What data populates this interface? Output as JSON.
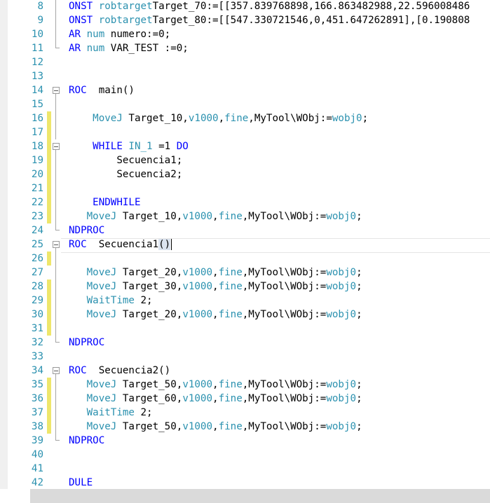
{
  "editor": {
    "lines": [
      {
        "n": "8",
        "m": "none",
        "f": "v",
        "s": [
          [
            "kw",
            "ONST "
          ],
          [
            "ty",
            "robtarget"
          ],
          [
            "",
            "Target_70:=[[357.839768898,166.863482988,22.596008486"
          ]
        ]
      },
      {
        "n": "9",
        "m": "none",
        "f": "v",
        "s": [
          [
            "kw",
            "ONST "
          ],
          [
            "ty",
            "robtarget"
          ],
          [
            "",
            "Target_80:=[[547.330721546,0,451.647262891],[0.190808"
          ]
        ]
      },
      {
        "n": "10",
        "m": "none",
        "f": "v",
        "s": [
          [
            "kw",
            "AR "
          ],
          [
            "ty",
            "num"
          ],
          [
            "",
            " numero:=0;"
          ]
        ]
      },
      {
        "n": "11",
        "m": "none",
        "f": "end",
        "s": [
          [
            "kw",
            "AR "
          ],
          [
            "ty",
            "num"
          ],
          [
            "",
            " VAR_TEST :=0;"
          ]
        ]
      },
      {
        "n": "12",
        "m": "none",
        "f": "",
        "s": []
      },
      {
        "n": "13",
        "m": "none",
        "f": "",
        "s": []
      },
      {
        "n": "14",
        "m": "none",
        "f": "box",
        "s": [
          [
            "kw",
            "ROC "
          ],
          [
            "",
            " main()"
          ]
        ]
      },
      {
        "n": "15",
        "m": "none",
        "f": "v",
        "s": []
      },
      {
        "n": "16",
        "m": "changed",
        "f": "v",
        "s": [
          [
            "",
            "    "
          ],
          [
            "ty",
            "MoveJ"
          ],
          [
            "",
            " Target_10,"
          ],
          [
            "ty",
            "v1000"
          ],
          [
            "",
            ","
          ],
          [
            "ty",
            "fine"
          ],
          [
            "",
            ",MyTool\\WObj:="
          ],
          [
            "ty",
            "wobj0"
          ],
          [
            "",
            ";"
          ]
        ]
      },
      {
        "n": "17",
        "m": "changed",
        "f": "v",
        "s": []
      },
      {
        "n": "18",
        "m": "changed",
        "f": "box",
        "s": [
          [
            "",
            "    "
          ],
          [
            "kw",
            "WHILE "
          ],
          [
            "ty",
            "IN_1"
          ],
          [
            "",
            " =1 "
          ],
          [
            "kw",
            "DO"
          ]
        ]
      },
      {
        "n": "19",
        "m": "changed",
        "f": "v",
        "s": [
          [
            "",
            "        Secuencia1;"
          ]
        ]
      },
      {
        "n": "20",
        "m": "changed",
        "f": "v",
        "s": [
          [
            "",
            "        Secuencia2;"
          ]
        ]
      },
      {
        "n": "21",
        "m": "changed",
        "f": "v",
        "s": []
      },
      {
        "n": "22",
        "m": "changed",
        "f": "v",
        "s": [
          [
            "",
            "    "
          ],
          [
            "kw",
            "ENDWHILE"
          ]
        ]
      },
      {
        "n": "23",
        "m": "changed",
        "f": "v",
        "s": [
          [
            "",
            "   "
          ],
          [
            "ty",
            "MoveJ"
          ],
          [
            "",
            " Target_10,"
          ],
          [
            "ty",
            "v1000"
          ],
          [
            "",
            ","
          ],
          [
            "ty",
            "fine"
          ],
          [
            "",
            ",MyTool\\WObj:="
          ],
          [
            "ty",
            "wobj0"
          ],
          [
            "",
            ";"
          ]
        ]
      },
      {
        "n": "24",
        "m": "none",
        "f": "end",
        "s": [
          [
            "kw",
            "NDPROC"
          ]
        ]
      },
      {
        "n": "25",
        "m": "none",
        "f": "box",
        "s": [
          [
            "kw",
            "ROC "
          ],
          [
            "",
            " Secuencia1"
          ],
          [
            "paren",
            "()"
          ],
          [
            "caret",
            ""
          ]
        ]
      },
      {
        "n": "26",
        "m": "changed",
        "f": "v",
        "s": []
      },
      {
        "n": "27",
        "m": "none",
        "f": "v",
        "s": [
          [
            "",
            "   "
          ],
          [
            "ty",
            "MoveJ"
          ],
          [
            "",
            " Target_20,"
          ],
          [
            "ty",
            "v1000"
          ],
          [
            "",
            ","
          ],
          [
            "ty",
            "fine"
          ],
          [
            "",
            ",MyTool\\WObj:="
          ],
          [
            "ty",
            "wobj0"
          ],
          [
            "",
            ";"
          ]
        ]
      },
      {
        "n": "28",
        "m": "changed",
        "f": "v",
        "s": [
          [
            "",
            "   "
          ],
          [
            "ty",
            "MoveJ"
          ],
          [
            "",
            " Target_30,"
          ],
          [
            "ty",
            "v1000"
          ],
          [
            "",
            ","
          ],
          [
            "ty",
            "fine"
          ],
          [
            "",
            ",MyTool\\WObj:="
          ],
          [
            "ty",
            "wobj0"
          ],
          [
            "",
            ";"
          ]
        ]
      },
      {
        "n": "29",
        "m": "changed",
        "f": "v",
        "s": [
          [
            "",
            "   "
          ],
          [
            "ty",
            "WaitTime"
          ],
          [
            "",
            " 2;"
          ]
        ]
      },
      {
        "n": "30",
        "m": "changed",
        "f": "v",
        "s": [
          [
            "",
            "   "
          ],
          [
            "ty",
            "MoveJ"
          ],
          [
            "",
            " Target_20,"
          ],
          [
            "ty",
            "v1000"
          ],
          [
            "",
            ","
          ],
          [
            "ty",
            "fine"
          ],
          [
            "",
            ",MyTool\\WObj:="
          ],
          [
            "ty",
            "wobj0"
          ],
          [
            "",
            ";"
          ]
        ]
      },
      {
        "n": "31",
        "m": "changed",
        "f": "v",
        "s": []
      },
      {
        "n": "32",
        "m": "none",
        "f": "end",
        "s": [
          [
            "kw",
            "NDPROC"
          ]
        ]
      },
      {
        "n": "33",
        "m": "none",
        "f": "",
        "s": []
      },
      {
        "n": "34",
        "m": "none",
        "f": "box",
        "s": [
          [
            "kw",
            "ROC "
          ],
          [
            "",
            " Secuencia2()"
          ]
        ]
      },
      {
        "n": "35",
        "m": "changed",
        "f": "v",
        "s": [
          [
            "",
            "   "
          ],
          [
            "ty",
            "MoveJ"
          ],
          [
            "",
            " Target_50,"
          ],
          [
            "ty",
            "v1000"
          ],
          [
            "",
            ","
          ],
          [
            "ty",
            "fine"
          ],
          [
            "",
            ",MyTool\\WObj:="
          ],
          [
            "ty",
            "wobj0"
          ],
          [
            "",
            ";"
          ]
        ]
      },
      {
        "n": "36",
        "m": "changed",
        "f": "v",
        "s": [
          [
            "",
            "   "
          ],
          [
            "ty",
            "MoveJ"
          ],
          [
            "",
            " Target_60,"
          ],
          [
            "ty",
            "v1000"
          ],
          [
            "",
            ","
          ],
          [
            "ty",
            "fine"
          ],
          [
            "",
            ",MyTool\\WObj:="
          ],
          [
            "ty",
            "wobj0"
          ],
          [
            "",
            ";"
          ]
        ]
      },
      {
        "n": "37",
        "m": "changed",
        "f": "v",
        "s": [
          [
            "",
            "   "
          ],
          [
            "ty",
            "WaitTime"
          ],
          [
            "",
            " 2;"
          ]
        ]
      },
      {
        "n": "38",
        "m": "changed",
        "f": "v",
        "s": [
          [
            "",
            "   "
          ],
          [
            "ty",
            "MoveJ"
          ],
          [
            "",
            " Target_50,"
          ],
          [
            "ty",
            "v1000"
          ],
          [
            "",
            ","
          ],
          [
            "ty",
            "fine"
          ],
          [
            "",
            ",MyTool\\WObj:="
          ],
          [
            "ty",
            "wobj0"
          ],
          [
            "",
            ";"
          ]
        ]
      },
      {
        "n": "39",
        "m": "none",
        "f": "end",
        "s": [
          [
            "kw",
            "NDPROC"
          ]
        ]
      },
      {
        "n": "40",
        "m": "none",
        "f": "",
        "s": []
      },
      {
        "n": "41",
        "m": "none",
        "f": "",
        "s": []
      },
      {
        "n": "42",
        "m": "none",
        "f": "",
        "s": [
          [
            "kw",
            "DULE"
          ]
        ]
      }
    ]
  }
}
